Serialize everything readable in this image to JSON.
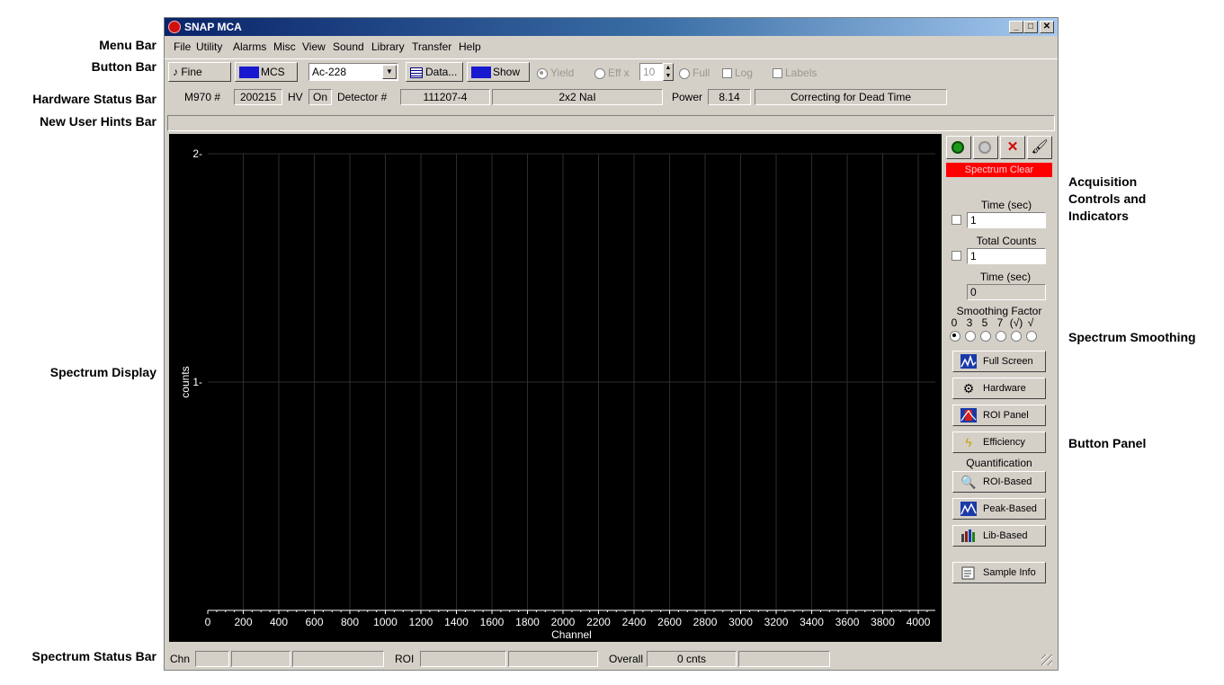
{
  "callouts": {
    "menu_bar": "Menu Bar",
    "button_bar": "Button Bar",
    "hardware_status_bar": "Hardware Status Bar",
    "new_user_hints_bar": "New User Hints Bar",
    "spectrum_display": "Spectrum Display",
    "spectrum_status_bar": "Spectrum Status Bar",
    "acquisition_line1": "Acquisition",
    "acquisition_line2": "Controls and",
    "acquisition_line3": "Indicators",
    "spectrum_smoothing": "Spectrum Smoothing",
    "button_panel": "Button Panel"
  },
  "window": {
    "title": "SNAP MCA"
  },
  "menu": [
    "File",
    "Utility",
    "Alarms",
    "Misc",
    "View",
    "Sound",
    "Library",
    "Transfer",
    "Help"
  ],
  "buttonbar": {
    "fine": "Fine",
    "mcs": "MCS",
    "nuclide": "Ac-228",
    "data": "Data...",
    "show": "Show",
    "yield": "Yield",
    "eff": "Eff x",
    "eff_value": "10",
    "full": "Full",
    "log": "Log",
    "labels": "Labels"
  },
  "hardware": {
    "model_label": "M970 #",
    "model_value": "200215",
    "hv_label": "HV",
    "hv_value": "On",
    "detector_label": "Detector #",
    "detector_value": "111207-4",
    "detector_type": "2x2 NaI",
    "power_label": "Power",
    "power_value": "8.14",
    "status": "Correcting for Dead Time"
  },
  "chart_data": {
    "type": "line",
    "xlabel": "Channel",
    "ylabel": "counts",
    "xlim": [
      0,
      4096
    ],
    "ylim": [
      0,
      2
    ],
    "xticks": [
      0,
      200,
      400,
      600,
      800,
      1000,
      1200,
      1400,
      1600,
      1800,
      2000,
      2200,
      2400,
      2600,
      2800,
      3000,
      3200,
      3400,
      3600,
      3800,
      4000
    ],
    "yticks": [
      1,
      2
    ],
    "grid": true,
    "series": []
  },
  "panel": {
    "status": "Spectrum Clear",
    "status_color": "#ff0000",
    "time_label": "Time (sec)",
    "time_value": "1",
    "total_counts_label": "Total Counts",
    "total_counts_value": "1",
    "elapsed_label": "Time (sec)",
    "elapsed_value": "0",
    "smoothing_label": "Smoothing Factor",
    "smoothing_options": [
      "0",
      "3",
      "5",
      "7",
      "(√)",
      "√"
    ],
    "smoothing_selected": 0,
    "full_screen": "Full Screen",
    "hardware": "Hardware",
    "roi_panel": "ROI Panel",
    "efficiency": "Efficiency",
    "quantification": "Quantification",
    "roi_based": "ROI-Based",
    "peak_based": "Peak-Based",
    "lib_based": "Lib-Based",
    "sample_info": "Sample Info"
  },
  "status": {
    "chn": "Chn",
    "roi": "ROI",
    "overall": "Overall",
    "counts": "0 cnts"
  }
}
